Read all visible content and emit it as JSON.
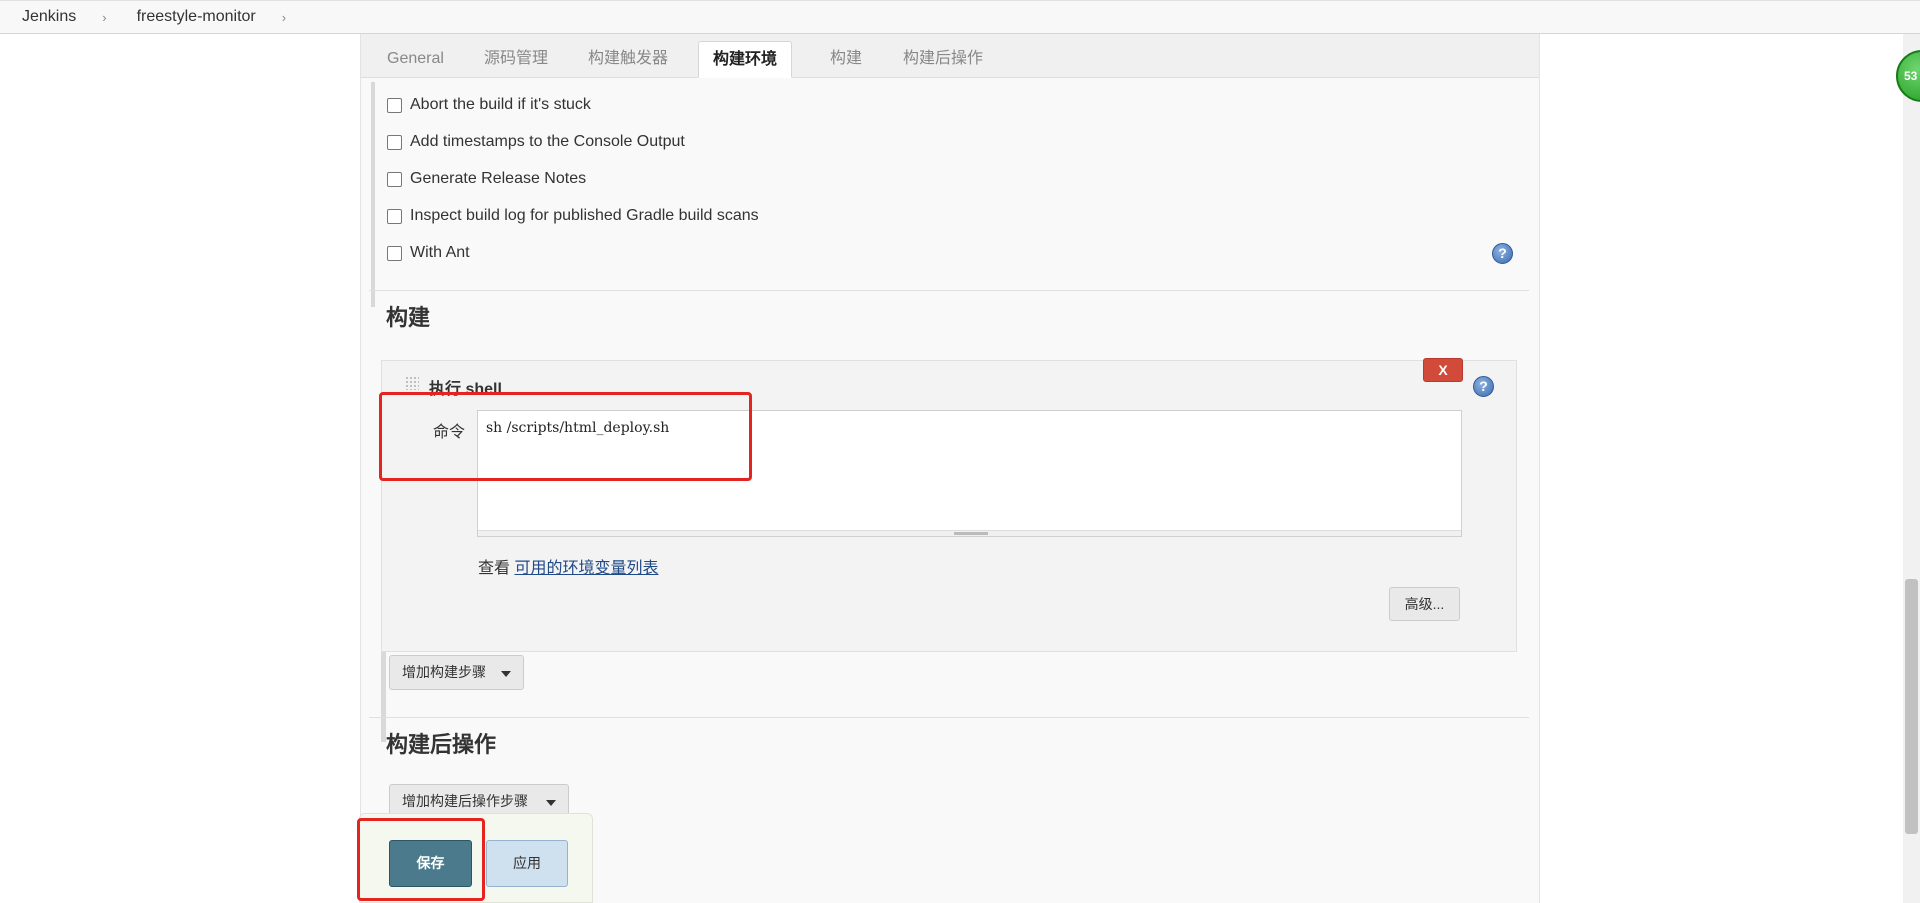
{
  "breadcrumb": {
    "root": "Jenkins",
    "job": "freestyle-monitor"
  },
  "tabs": [
    "General",
    "源码管理",
    "构建触发器",
    "构建环境",
    "构建",
    "构建后操作"
  ],
  "active_tab": "构建环境",
  "build_env": {
    "options": [
      "Abort the build if it's stuck",
      "Add timestamps to the Console Output",
      "Generate Release Notes",
      "Inspect build log for published Gradle build scans",
      "With Ant"
    ]
  },
  "build": {
    "section_title": "构建",
    "step_title": "执行 shell",
    "delete_label": "X",
    "command_label": "命令",
    "command_value": "sh /scripts/html_deploy.sh",
    "env_prefix": "查看",
    "env_link": "可用的环境变量列表",
    "advanced_label": "高级...",
    "add_step_label": "增加构建步骤"
  },
  "post_build": {
    "section_title": "构建后操作",
    "add_step_label": "增加构建后操作步骤"
  },
  "actions": {
    "save_label": "保存",
    "apply_label": "应用"
  },
  "help_glyph": "?",
  "badge_count": "53",
  "icons": [
    "help-icon",
    "drag-handle-icon",
    "caret-down-icon",
    "chevron-right-icon"
  ],
  "colors": {
    "highlight": "#e52420",
    "save": "#4a7a8c",
    "delete": "#d24a3a",
    "link": "#204a87"
  }
}
